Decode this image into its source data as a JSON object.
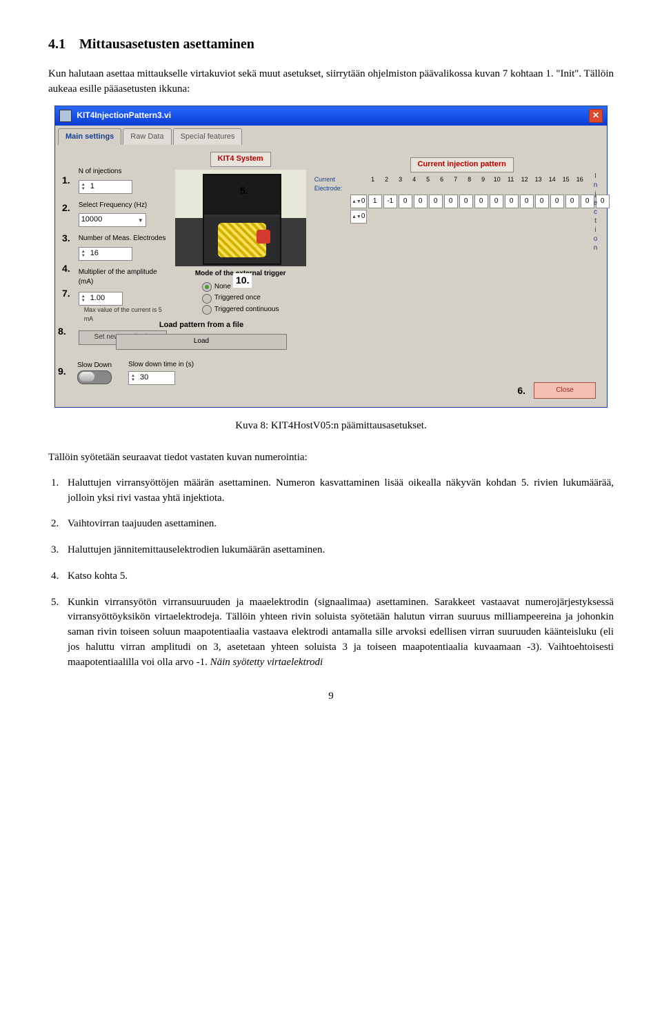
{
  "section_number": "4.1",
  "section_title": "Mittausasetusten asettaminen",
  "intro_para": "Kun halutaan asettaa mittaukselle virtakuviot sekä muut asetukset, siirrytään ohjelmiston päävalikossa kuvan 7 kohtaan 1. \"Init\". Tällöin aukeaa esille pääasetusten ikkuna:",
  "figure_caption": "Kuva 8: KIT4HostV05:n päämittausasetukset.",
  "after_figure_para": "Tällöin syötetään seuraavat tiedot vastaten kuvan numerointia:",
  "list": {
    "i1": "Haluttujen virransyöttöjen määrän asettaminen. Numeron kasvattaminen lisää oikealla näkyvän kohdan 5. rivien lukumäärää, jolloin yksi rivi vastaa yhtä injektiota.",
    "i2": "Vaihtovirran taajuuden asettaminen.",
    "i3": "Haluttujen jännitemittauselektrodien lukumäärän asettaminen.",
    "i4": "Katso kohta 5.",
    "i5a": "Kunkin virransyötön virransuuruuden ja maaelektrodin (signaalimaa) asettaminen. Sarakkeet vastaavat numerojärjestyksessä virransyöttöyksikön virtaelektrodeja. Tällöin yhteen rivin soluista syötetään halutun virran suuruus milliampeereina ja johonkin saman rivin toiseen soluun maapotentiaalia vastaava elektrodi antamalla sille arvoksi edellisen virran suuruuden käänteisluku (eli jos haluttu virran amplitudi on 3, asetetaan yhteen soluista 3 ja toiseen maapotentiaalia kuvaamaan -3). Vaihtoehtoisesti maapotentiaalilla voi olla arvo -1. ",
    "i5b": "Näin syötetty virtaelektrodi"
  },
  "page_number": "9",
  "app": {
    "title": "KIT4InjectionPattern3.vi",
    "tabs": {
      "t1": "Main settings",
      "t2": "Raw Data",
      "t3": "Special features"
    },
    "labels": {
      "n_injections": "N of injections",
      "freq": "Select Frequency (Hz)",
      "n_electrodes": "Number of Meas. Electrodes",
      "multiplier": "Multiplier of the amplitude (mA)",
      "max_note": "Max value of the current is 5 mA",
      "set_amp_btn": "Set new amplitude",
      "kit_system": "KIT4 System",
      "mode_trig": "Mode of the external trigger",
      "mode_none": "None",
      "mode_once": "Triggered once",
      "mode_cont": "Triggered continuous",
      "inj_title": "Current injection pattern",
      "cur_elec": "Current Electrode:",
      "load_label": "Load pattern from a file",
      "load_btn": "Load",
      "slow_down": "Slow Down",
      "slow_time": "Slow down time in (s)",
      "close_btn": "Close"
    },
    "values": {
      "n_injections": "1",
      "freq": "10000",
      "n_electrodes": "16",
      "multiplier": "1.00",
      "row1_spin": "0",
      "row2_spin": "0",
      "slow_time": "30"
    },
    "electrode_headers": [
      "1",
      "2",
      "3",
      "4",
      "5",
      "6",
      "7",
      "8",
      "9",
      "10",
      "11",
      "12",
      "13",
      "14",
      "15",
      "16"
    ],
    "pattern_row": [
      "1",
      "-1",
      "0",
      "0",
      "0",
      "0",
      "0",
      "0",
      "0",
      "0",
      "0",
      "0",
      "0",
      "0",
      "0",
      "0"
    ],
    "inj_word": "Injection",
    "callouts": {
      "c1": "1.",
      "c2": "2.",
      "c3": "3.",
      "c4": "4.",
      "c5": "5.",
      "c6": "6.",
      "c7": "7.",
      "c8": "8.",
      "c9": "9.",
      "c10": "10."
    }
  }
}
